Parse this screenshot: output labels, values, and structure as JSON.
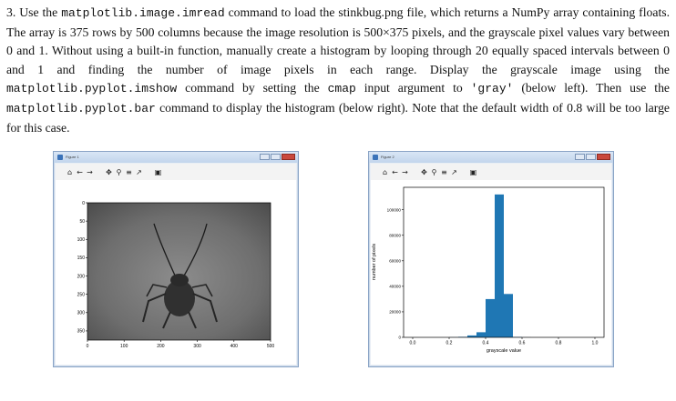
{
  "problem": {
    "number": "3.",
    "t1": "Use the ",
    "c1": "matplotlib.image.imread",
    "t2": " command to load the stinkbug.png file, which returns a NumPy array containing floats. The array is 375 rows by 500 columns because the image resolution is 500×375 pixels, and the grayscale pixel values vary between 0 and 1. Without using a built-in function, manually create a histogram by looping through 20 equally spaced intervals between 0 and 1 and finding the number of image pixels in each range. Display the grayscale image using the ",
    "c2": "matplotlib.pyplot.imshow",
    "t3": " command by setting the ",
    "c3": "cmap",
    "t4": " input argument to ",
    "c4": "'gray'",
    "t5": " (below left). Then use the ",
    "c5": "matplotlib.pyplot.bar",
    "t6": " command to display the histogram (below right). Note that the default width of 0.8 will be too large for this case."
  },
  "windows": [
    {
      "title": "Figure 1"
    },
    {
      "title": "Figure 2"
    }
  ],
  "toolbar_icons": [
    "home-icon",
    "back-arrow-icon",
    "forward-arrow-icon",
    "pan-icon",
    "zoom-icon",
    "subplots-icon",
    "edit-curve-icon",
    "save-icon"
  ],
  "toolbar_glyphs": [
    "⌂",
    "←",
    "→",
    "✥",
    "⚲",
    "≡",
    "↗",
    "▣"
  ],
  "chart_data": [
    {
      "type": "image",
      "xticks": [
        "0",
        "100",
        "200",
        "300",
        "400",
        "500"
      ],
      "yticks": [
        "0",
        "50",
        "100",
        "150",
        "200",
        "250",
        "300",
        "350"
      ],
      "xlim": [
        0,
        500
      ],
      "ylim": [
        375,
        0
      ]
    },
    {
      "type": "bar",
      "x": [
        0.025,
        0.075,
        0.125,
        0.175,
        0.225,
        0.275,
        0.325,
        0.375,
        0.425,
        0.475,
        0.525,
        0.575,
        0.625,
        0.675,
        0.725,
        0.775,
        0.825,
        0.875,
        0.925,
        0.975
      ],
      "values": [
        0,
        0,
        0,
        0,
        100,
        400,
        1500,
        4000,
        30000,
        112000,
        34000,
        300,
        50,
        0,
        0,
        0,
        0,
        0,
        0,
        0
      ],
      "bar_width": 0.05,
      "color": "#1f77b4",
      "xlabel": "grayscale value",
      "ylabel": "number of pixels",
      "xlim": [
        -0.05,
        1.05
      ],
      "ylim": [
        0,
        117600
      ],
      "xticks": [
        "0.0",
        "0.2",
        "0.4",
        "0.6",
        "0.8",
        "1.0"
      ],
      "yticks": [
        "0",
        "20000",
        "40000",
        "60000",
        "80000",
        "100000"
      ]
    }
  ]
}
